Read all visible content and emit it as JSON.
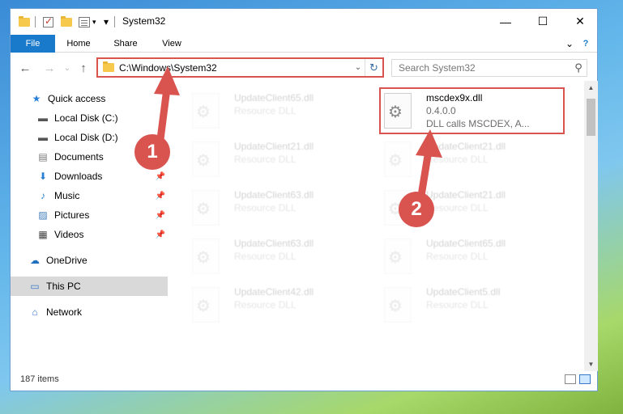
{
  "window": {
    "title": "System32",
    "minimize": "—",
    "maximize": "☐",
    "close": "✕",
    "help": "?",
    "ribbon_toggle": "⌄"
  },
  "ribbon": {
    "tabs": [
      "File",
      "Home",
      "Share",
      "View"
    ]
  },
  "nav": {
    "back": "←",
    "forward": "→",
    "recent": "⌄",
    "up": "↑",
    "address": "C:\\Windows\\System32",
    "search_placeholder": "Search System32"
  },
  "sidebar": {
    "items": [
      {
        "label": "Quick access",
        "icon": "star-icon"
      },
      {
        "label": "Local Disk (C:)",
        "icon": "drive-icon"
      },
      {
        "label": "Local Disk (D:)",
        "icon": "drive-icon"
      },
      {
        "label": "Documents",
        "icon": "document-icon"
      },
      {
        "label": "Downloads",
        "icon": "download-icon",
        "pinned": true
      },
      {
        "label": "Music",
        "icon": "music-icon",
        "pinned": true
      },
      {
        "label": "Pictures",
        "icon": "pictures-icon",
        "pinned": true
      },
      {
        "label": "Videos",
        "icon": "video-icon",
        "pinned": true
      },
      {
        "label": "OneDrive",
        "icon": "cloud-icon"
      },
      {
        "label": "This PC",
        "icon": "computer-icon",
        "selected": true
      },
      {
        "label": "Network",
        "icon": "network-icon"
      }
    ]
  },
  "files": {
    "highlighted": {
      "name": "mscdex9x.dll",
      "version": "0.4.0.0",
      "description": "DLL calls MSCDEX, A..."
    },
    "left_column": [
      {
        "name": "UpdateClient65.dll",
        "type": "Resource DLL"
      },
      {
        "name": "UpdateClient21.dll",
        "type": "Resource DLL"
      },
      {
        "name": "UpdateClient63.dll",
        "type": "Resource DLL"
      },
      {
        "name": "UpdateClient63.dll",
        "type": "Resource DLL"
      },
      {
        "name": "UpdateClient42.dll",
        "type": "Resource DLL"
      }
    ],
    "right_column": [
      {
        "name": "UpdateClient21.dll",
        "type": "Resource DLL"
      },
      {
        "name": "UpdateClient21.dll",
        "type": "Resource DLL"
      },
      {
        "name": "UpdateClient65.dll",
        "type": "Resource DLL"
      },
      {
        "name": "UpdateClient5.dll",
        "type": "Resource DLL"
      }
    ]
  },
  "status": {
    "item_count": "187 items"
  },
  "annotations": {
    "step1": "1",
    "step2": "2",
    "color": "#d9534f"
  }
}
